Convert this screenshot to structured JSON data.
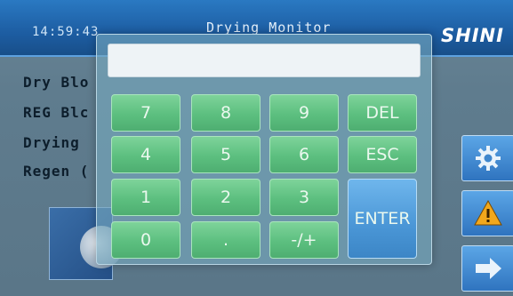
{
  "header": {
    "time": "14:59:43",
    "title": "Drying Monitor",
    "logo": "SHINI"
  },
  "status": [
    {
      "label": "Dry Blo"
    },
    {
      "label": "REG Blc"
    },
    {
      "label": "Drying"
    },
    {
      "label": "Regen ("
    }
  ],
  "keypad": {
    "input_value": "",
    "keys": [
      {
        "label": "7"
      },
      {
        "label": "8"
      },
      {
        "label": "9"
      },
      {
        "label": "DEL"
      },
      {
        "label": "4"
      },
      {
        "label": "5"
      },
      {
        "label": "6"
      },
      {
        "label": "ESC"
      },
      {
        "label": "1"
      },
      {
        "label": "2"
      },
      {
        "label": "3"
      },
      {
        "label": "0"
      },
      {
        "label": "."
      },
      {
        "label": "-/+"
      },
      {
        "label": "ENTER"
      }
    ]
  },
  "sidebar": {
    "buttons": [
      {
        "icon": "gear-icon"
      },
      {
        "icon": "warning-icon"
      },
      {
        "icon": "arrow-right-icon"
      }
    ]
  },
  "colors": {
    "header": "#1d5da2",
    "key_green": "#5cbf7f",
    "key_blue": "#4a96d6",
    "warning": "#f2a81c"
  }
}
